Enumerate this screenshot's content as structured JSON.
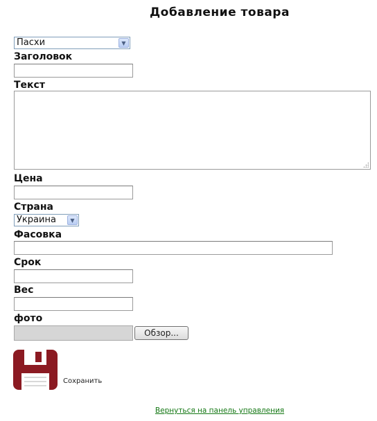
{
  "page": {
    "title": "Добавление товара"
  },
  "category_select": {
    "value": "Пасхи"
  },
  "fields": {
    "heading_label": "Заголовок",
    "text_label": "Текст",
    "price_label": "Цена",
    "country_label": "Страна",
    "packing_label": "Фасовка",
    "term_label": "Срок",
    "weight_label": "Вес",
    "photo_label": "фото"
  },
  "country_select": {
    "value": "Украина"
  },
  "file_input": {
    "browse_label": "Обзор..."
  },
  "save": {
    "label": "Сохранить",
    "icon": "floppy-disk-icon",
    "icon_color": "#8b1a22"
  },
  "footer": {
    "back_link": "Вернуться на панель управления",
    "link_color": "#137713"
  }
}
